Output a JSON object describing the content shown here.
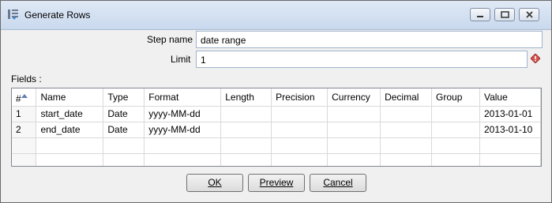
{
  "window": {
    "title": "Generate Rows",
    "icon": "generate-rows-app-icon",
    "controls": [
      "minimize-icon",
      "maximize-icon",
      "close-icon"
    ]
  },
  "form": {
    "step_name_label": "Step name",
    "step_name_value": "date range",
    "limit_label": "Limit",
    "limit_value": "1",
    "fields_label": "Fields :"
  },
  "table": {
    "columns": [
      "#",
      "Name",
      "Type",
      "Format",
      "Length",
      "Precision",
      "Currency",
      "Decimal",
      "Group",
      "Value"
    ],
    "rows": [
      [
        "1",
        "start_date",
        "Date",
        "yyyy-MM-dd",
        "",
        "",
        "",
        "",
        "",
        "2013-01-01"
      ],
      [
        "2",
        "end_date",
        "Date",
        "yyyy-MM-dd",
        "",
        "",
        "",
        "",
        "",
        "2013-01-10"
      ],
      [
        "",
        "",
        "",
        "",
        "",
        "",
        "",
        "",
        "",
        ""
      ],
      [
        "",
        "",
        "",
        "",
        "",
        "",
        "",
        "",
        "",
        ""
      ]
    ]
  },
  "buttons": {
    "ok": "OK",
    "preview": "Preview",
    "cancel": "Cancel"
  },
  "colors": {
    "titlebar": "#c9d9ee",
    "field_border": "#a0b4cc",
    "warning": "#d9534f"
  }
}
